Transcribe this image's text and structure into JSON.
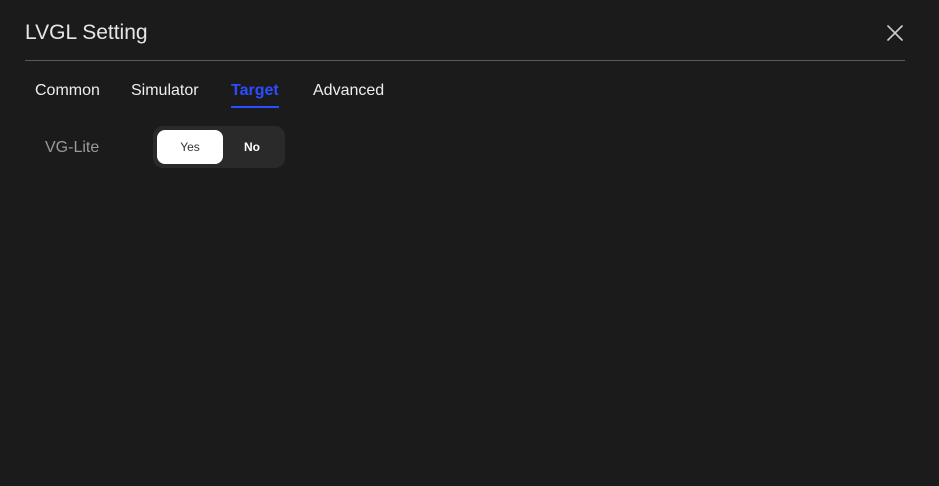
{
  "dialog": {
    "title": "LVGL Setting",
    "close_icon": "close-icon"
  },
  "tabs": [
    {
      "label": "Common",
      "active": false
    },
    {
      "label": "Simulator",
      "active": false
    },
    {
      "label": "Target",
      "active": true
    },
    {
      "label": "Advanced",
      "active": false
    }
  ],
  "target": {
    "vg_lite": {
      "label": "VG-Lite",
      "options": [
        "Yes",
        "No"
      ],
      "selected": "Yes"
    }
  },
  "colors": {
    "background": "#1b1b1b",
    "accent": "#2b4cff",
    "text": "#eeeeee",
    "muted": "#9a9a9a",
    "divider": "#5a5a5a",
    "toggle_bg": "#2a2a2a",
    "toggle_selected": "#ffffff"
  }
}
